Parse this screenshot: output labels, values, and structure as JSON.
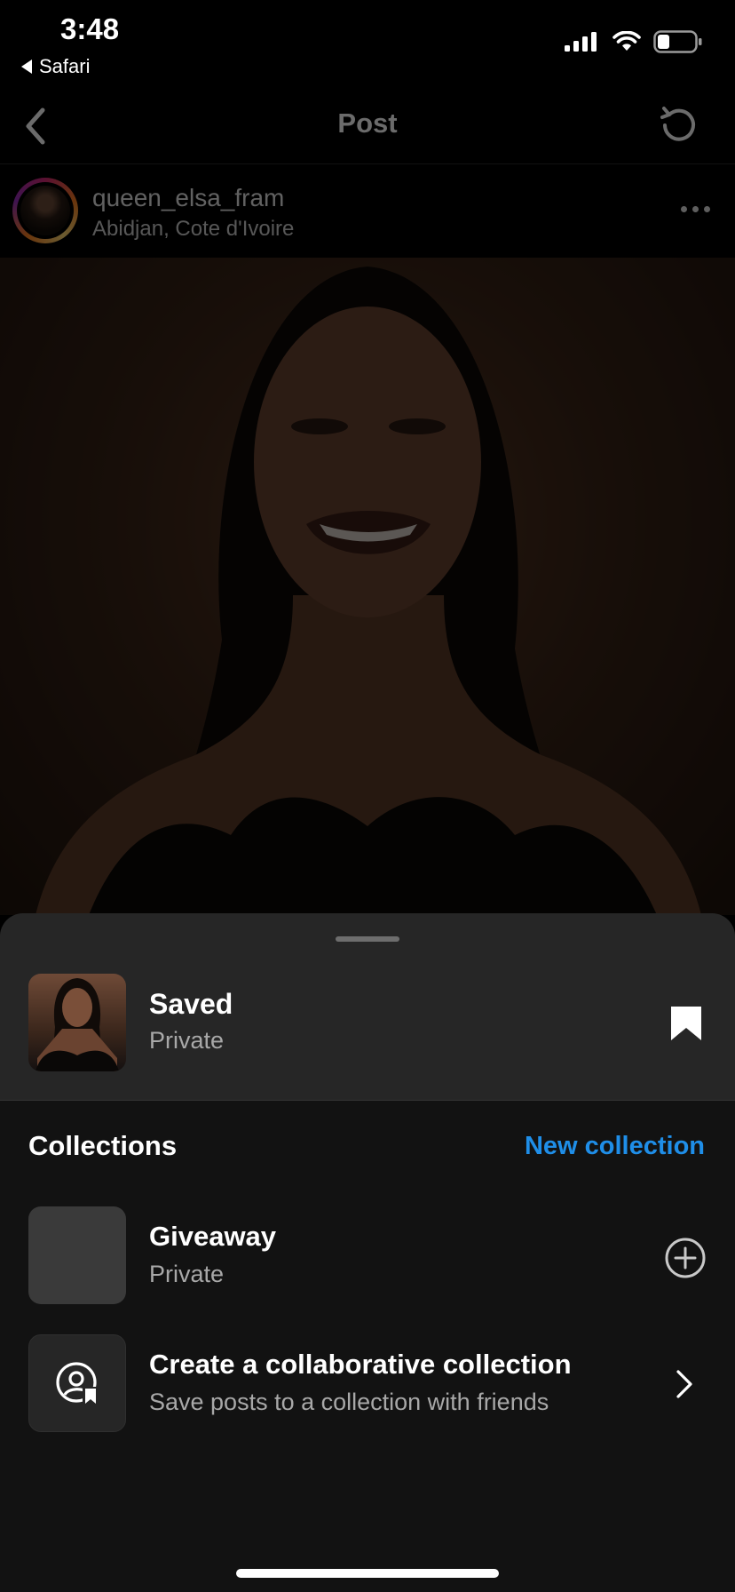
{
  "status_bar": {
    "time": "3:48",
    "back_app": "Safari",
    "icons": [
      "cellular-signal-icon",
      "wifi-icon",
      "battery-icon"
    ]
  },
  "nav": {
    "title": "Post",
    "back_icon": "chevron-left-icon",
    "refresh_icon": "refresh-icon"
  },
  "post": {
    "username": "queen_elsa_fram",
    "location": "Abidjan, Cote d'Ivoire",
    "more_icon": "more-horizontal-icon"
  },
  "sheet": {
    "saved": {
      "title": "Saved",
      "subtitle": "Private",
      "icon": "bookmark-filled-icon"
    },
    "collections_heading": "Collections",
    "new_collection_label": "New collection",
    "items": [
      {
        "title": "Giveaway",
        "subtitle": "Private",
        "action_icon": "plus-circle-icon"
      },
      {
        "title": "Create a collaborative collection",
        "subtitle": "Save posts to a collection with friends",
        "action_icon": "chevron-right-icon"
      }
    ]
  },
  "colors": {
    "accent": "#1f8ee8",
    "sheet_background": "#121212",
    "sheet_header_background": "#262626"
  }
}
